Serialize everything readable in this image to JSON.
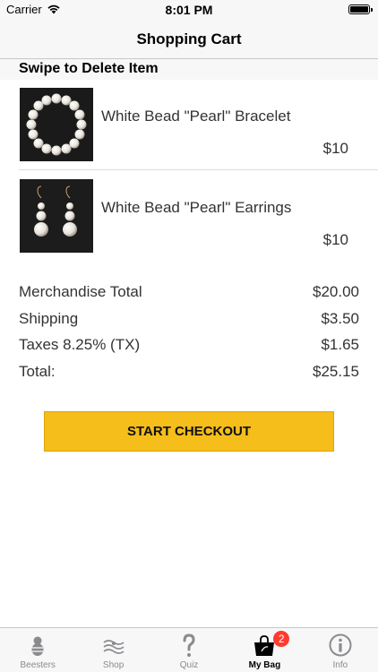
{
  "status_bar": {
    "carrier": "Carrier",
    "time": "8:01 PM"
  },
  "nav": {
    "title": "Shopping Cart"
  },
  "section": {
    "header": "Swipe to Delete Item"
  },
  "items": [
    {
      "name": "White Bead \"Pearl\" Bracelet",
      "price": "$10",
      "image": "pearl-bracelet-photo"
    },
    {
      "name": "White Bead \"Pearl\" Earrings",
      "price": "$10",
      "image": "pearl-earrings-photo"
    }
  ],
  "summary": [
    {
      "label": "Merchandise Total",
      "value": "$20.00"
    },
    {
      "label": "Shipping",
      "value": "$3.50"
    },
    {
      "label": "Taxes 8.25% (TX)",
      "value": "$1.65"
    },
    {
      "label": "Total:",
      "value": "$25.15"
    }
  ],
  "checkout": {
    "label": "START CHECKOUT",
    "color": "#f5be1a"
  },
  "tabs": [
    {
      "label": "Beesters",
      "icon": "beester-icon"
    },
    {
      "label": "Shop",
      "icon": "shop-icon"
    },
    {
      "label": "Quiz",
      "icon": "question-mark-icon"
    },
    {
      "label": "My Bag",
      "icon": "bag-icon",
      "badge": "2",
      "active": true
    },
    {
      "label": "Info",
      "icon": "info-icon"
    }
  ],
  "colors": {
    "badge": "#ff3b30",
    "tab_inactive": "#8a8a8f",
    "bar_background": "#f7f7f7"
  }
}
